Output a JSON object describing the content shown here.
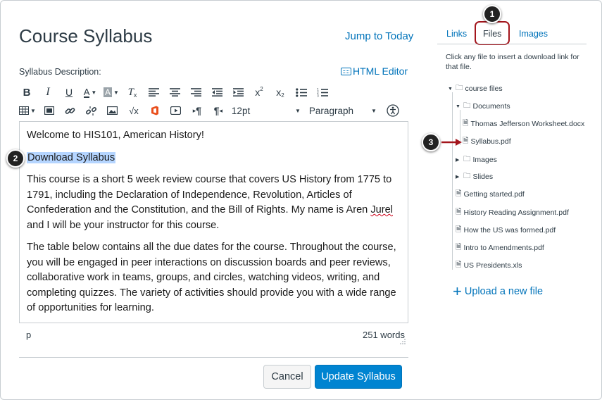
{
  "header": {
    "title": "Course Syllabus",
    "jump_link": "Jump to Today"
  },
  "editor": {
    "description_label": "Syllabus Description:",
    "html_editor_label": "HTML Editor",
    "font_size": "12pt",
    "block_format": "Paragraph",
    "content": {
      "welcome": "Welcome to HIS101, American History!",
      "selected_text": "Download Syllabus",
      "paragraph1_before": "This course is a short 5 week review course that covers US History from 1775 to 1791, including the Declaration of Independence, Revolution, Articles of Confederation and the Constitution, and the Bill of Rights. My name is Aren ",
      "paragraph1_misspelled": "Jurel",
      "paragraph1_after": " and I will be your instructor for this course.",
      "paragraph2": "The table below contains all the due dates for the course. Throughout the course, you will be engaged in peer interactions on discussion boards and peer reviews, collaborative work in teams, groups, and circles, watching videos, writing, and completing quizzes. The variety of activities should provide you with a wide range of opportunities for learning."
    },
    "status_path": "p",
    "word_count": "251 words"
  },
  "actions": {
    "cancel": "Cancel",
    "update": "Update Syllabus"
  },
  "sidebar": {
    "tabs": [
      {
        "label": "Links"
      },
      {
        "label": "Files"
      },
      {
        "label": "Images"
      }
    ],
    "active_tab": "Files",
    "hint": "Click any file to insert a download link for that file.",
    "tree": {
      "root": "course files",
      "documents": "Documents",
      "doc_files": [
        "Thomas Jefferson Worksheet.docx",
        "Syllabus.pdf"
      ],
      "images": "Images",
      "slides": "Slides",
      "root_files": [
        "Getting started.pdf",
        "History Reading Assignment.pdf",
        "How the US was formed.pdf",
        "Intro to Amendments.pdf",
        "US Presidents.xls"
      ]
    },
    "upload": "Upload a new file"
  },
  "callouts": [
    "1",
    "2",
    "3"
  ],
  "colors": {
    "link": "#0073ba",
    "primary_button": "#0084d1",
    "highlight": "#b5d5ff",
    "callout_outline": "#a3151c"
  }
}
